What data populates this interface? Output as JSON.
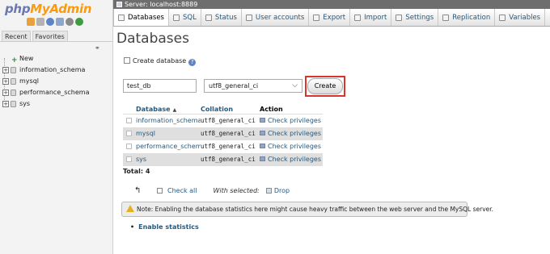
{
  "logo": {
    "part1": "php",
    "part2": "MyAdmin"
  },
  "nav": {
    "tabs": [
      "Recent",
      "Favorites"
    ],
    "tree": [
      {
        "label": "New",
        "type": "new"
      },
      {
        "label": "information_schema",
        "type": "db"
      },
      {
        "label": "mysql",
        "type": "db"
      },
      {
        "label": "performance_schema",
        "type": "db"
      },
      {
        "label": "sys",
        "type": "db"
      }
    ]
  },
  "server_bar": {
    "label": "Server: localhost:8889"
  },
  "tabs": [
    {
      "label": "Databases",
      "active": true
    },
    {
      "label": "SQL"
    },
    {
      "label": "Status"
    },
    {
      "label": "User accounts"
    },
    {
      "label": "Export"
    },
    {
      "label": "Import"
    },
    {
      "label": "Settings"
    },
    {
      "label": "Replication"
    },
    {
      "label": "Variables"
    }
  ],
  "page": {
    "title": "Databases",
    "create_label": "Create database",
    "db_name_value": "test_db",
    "collation_value": "utf8_general_ci",
    "create_button": "Create"
  },
  "table": {
    "headers": {
      "name": "Database",
      "collation": "Collation",
      "action": "Action"
    },
    "rows": [
      {
        "name": "information_schema",
        "collation": "utf8_general_ci",
        "action": "Check privileges"
      },
      {
        "name": "mysql",
        "collation": "utf8_general_ci",
        "action": "Check privileges"
      },
      {
        "name": "performance_schema",
        "collation": "utf8_general_ci",
        "action": "Check privileges"
      },
      {
        "name": "sys",
        "collation": "utf8_general_ci",
        "action": "Check privileges"
      }
    ],
    "total": "Total: 4"
  },
  "bulk": {
    "check_all": "Check all",
    "with_selected": "With selected:",
    "drop": "Drop"
  },
  "note": "Note: Enabling the database statistics here might cause heavy traffic between the web server and the MySQL server.",
  "enable_statistics": "Enable statistics",
  "colors": {
    "link": "#235a81",
    "highlight": "#d9352c",
    "server_bar": "#6e6e6e"
  }
}
